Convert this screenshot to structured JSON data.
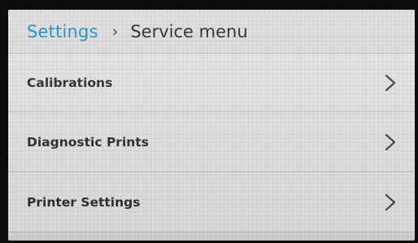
{
  "breadcrumb": {
    "root": "Settings",
    "separator": "›",
    "current": "Service menu"
  },
  "menu": {
    "items": [
      {
        "label": "Calibrations",
        "icon": "chevron-right-icon"
      },
      {
        "label": "Diagnostic Prints",
        "icon": "chevron-right-icon"
      },
      {
        "label": "Printer Settings",
        "icon": "chevron-right-icon"
      }
    ]
  },
  "colors": {
    "accent": "#1e92c9",
    "text": "#2f2f2f",
    "background": "#e4e4e4"
  }
}
